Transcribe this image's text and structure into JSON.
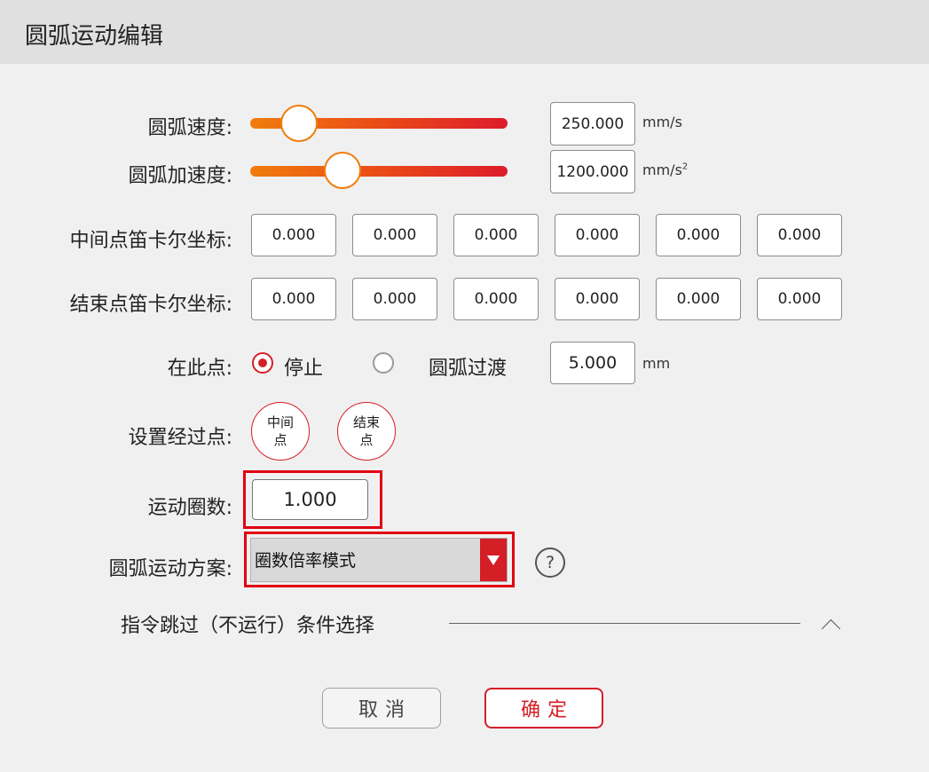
{
  "window": {
    "title": "圆弧运动编辑"
  },
  "arc_speed": {
    "label": "圆弧速度:",
    "value": "250.000",
    "unit": "mm/s",
    "level": 0.19
  },
  "arc_accel": {
    "label": "圆弧加速度:",
    "value": "1200.000",
    "unit_base": "mm/s",
    "unit_sup": "2",
    "level": 0.36
  },
  "mid_point": {
    "label": "中间点笛卡尔坐标:",
    "values": [
      "0.000",
      "0.000",
      "0.000",
      "0.000",
      "0.000",
      "0.000"
    ]
  },
  "end_point": {
    "label": "结束点笛卡尔坐标:",
    "values": [
      "0.000",
      "0.000",
      "0.000",
      "0.000",
      "0.000",
      "0.000"
    ]
  },
  "at_point": {
    "label": "在此点:",
    "option_stop": "停止",
    "option_blend": "圆弧过渡",
    "selected": "停止",
    "blend_value": "5.000",
    "blend_unit": "mm"
  },
  "via_points": {
    "label": "设置经过点:",
    "mid_button": "中间\n点",
    "end_button": "结束\n点"
  },
  "turns": {
    "label": "运动圈数:",
    "value": "1.000"
  },
  "scheme": {
    "label": "圆弧运动方案:",
    "selected": "圈数倍率模式",
    "help": "?"
  },
  "skip_section": {
    "label": "指令跳过（不运行）条件选择"
  },
  "actions": {
    "cancel": "取消",
    "ok": "确定"
  },
  "colors": {
    "accent": "#d41f26",
    "slider_start": "#f07d0c",
    "slider_end": "#dc1c2a",
    "highlight": "#e00012"
  }
}
